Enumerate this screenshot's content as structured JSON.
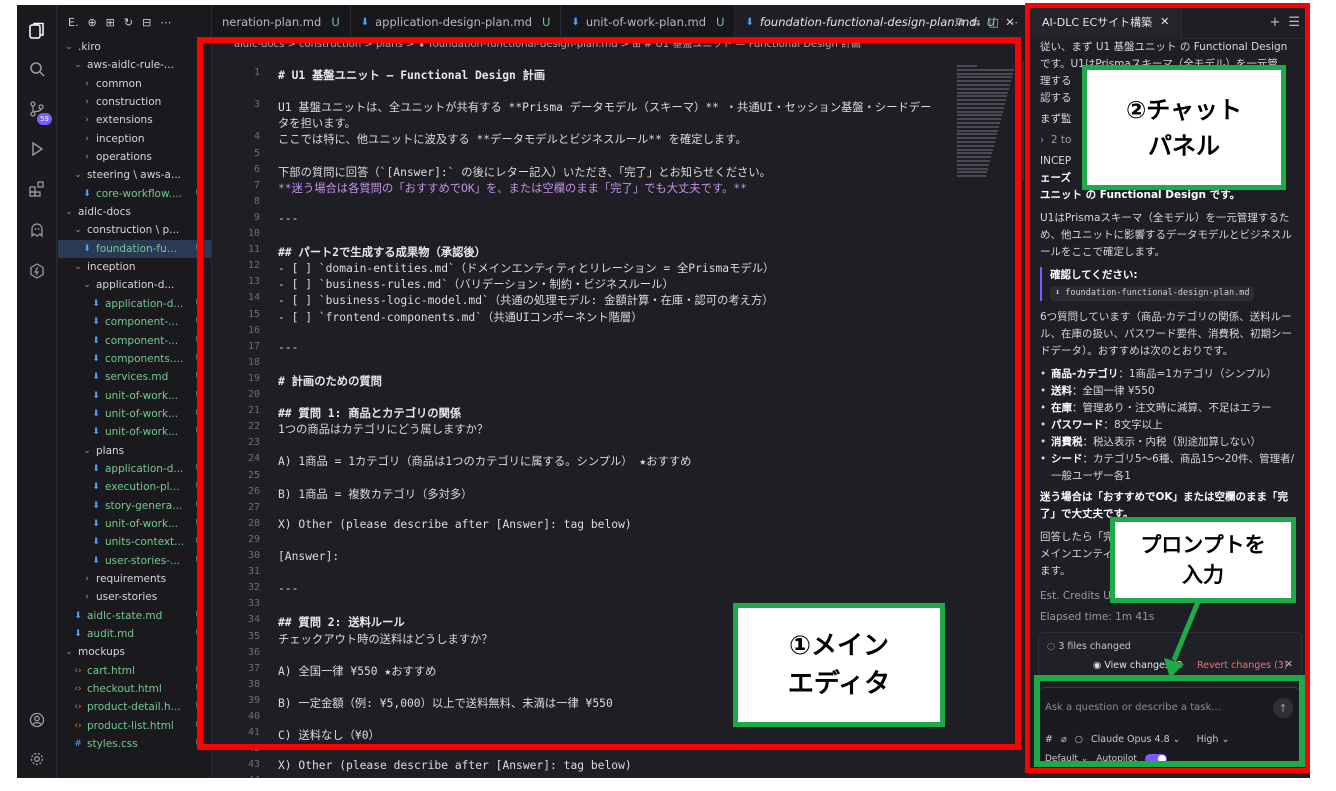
{
  "activity_bar": {
    "icons": [
      "explorer-icon",
      "search-icon",
      "source-control-icon",
      "run-debug-icon",
      "extensions-icon",
      "kiro-ghost-icon",
      "kiro-spec-icon",
      "account-icon",
      "settings-icon"
    ],
    "scm_badge": "59"
  },
  "explorer": {
    "header": "E.",
    "items": [
      {
        "label": ".kiro",
        "depth": 0,
        "kind": "folder",
        "open": true,
        "status": "dot"
      },
      {
        "label": "aws-aidlc-rule-...",
        "depth": 1,
        "kind": "folder",
        "open": true,
        "status": "dot"
      },
      {
        "label": "common",
        "depth": 2,
        "kind": "folder",
        "open": false,
        "status": "dot"
      },
      {
        "label": "construction",
        "depth": 2,
        "kind": "folder",
        "open": false,
        "status": "dot"
      },
      {
        "label": "extensions",
        "depth": 2,
        "kind": "folder",
        "open": false,
        "status": "dot"
      },
      {
        "label": "inception",
        "depth": 2,
        "kind": "folder",
        "open": false,
        "status": "dot"
      },
      {
        "label": "operations",
        "depth": 2,
        "kind": "folder",
        "open": false,
        "status": "dot"
      },
      {
        "label": "steering \\ aws-a...",
        "depth": 1,
        "kind": "folder",
        "open": true,
        "status": "dot"
      },
      {
        "label": "core-workflow....",
        "depth": 2,
        "kind": "md",
        "status": "U"
      },
      {
        "label": "aidlc-docs",
        "depth": 0,
        "kind": "folder",
        "open": true,
        "status": "dot"
      },
      {
        "label": "construction \\ p...",
        "depth": 1,
        "kind": "folder",
        "open": true,
        "status": "dot"
      },
      {
        "label": "foundation-fu...",
        "depth": 2,
        "kind": "md",
        "status": "U",
        "selected": true
      },
      {
        "label": "inception",
        "depth": 1,
        "kind": "folder",
        "open": true,
        "status": "dot"
      },
      {
        "label": "application-d...",
        "depth": 2,
        "kind": "folder",
        "open": true,
        "status": "dot"
      },
      {
        "label": "application-d...",
        "depth": 3,
        "kind": "md",
        "status": "U"
      },
      {
        "label": "component-...",
        "depth": 3,
        "kind": "md",
        "status": "U"
      },
      {
        "label": "component-...",
        "depth": 3,
        "kind": "md",
        "status": "U"
      },
      {
        "label": "components....",
        "depth": 3,
        "kind": "md",
        "status": "U"
      },
      {
        "label": "services.md",
        "depth": 3,
        "kind": "md",
        "status": "U"
      },
      {
        "label": "unit-of-work...",
        "depth": 3,
        "kind": "md",
        "status": "U"
      },
      {
        "label": "unit-of-work...",
        "depth": 3,
        "kind": "md",
        "status": "U"
      },
      {
        "label": "unit-of-work...",
        "depth": 3,
        "kind": "md",
        "status": "U"
      },
      {
        "label": "plans",
        "depth": 2,
        "kind": "folder",
        "open": true,
        "status": "dot"
      },
      {
        "label": "application-d...",
        "depth": 3,
        "kind": "md",
        "status": "U"
      },
      {
        "label": "execution-pl...",
        "depth": 3,
        "kind": "md",
        "status": "U"
      },
      {
        "label": "story-genera...",
        "depth": 3,
        "kind": "md",
        "status": "U"
      },
      {
        "label": "unit-of-work...",
        "depth": 3,
        "kind": "md",
        "status": "U"
      },
      {
        "label": "units-context...",
        "depth": 3,
        "kind": "md",
        "status": "U"
      },
      {
        "label": "user-stories-...",
        "depth": 3,
        "kind": "md",
        "status": "U"
      },
      {
        "label": "requirements",
        "depth": 2,
        "kind": "folder",
        "open": false,
        "status": "dot"
      },
      {
        "label": "user-stories",
        "depth": 2,
        "kind": "folder",
        "open": false,
        "status": "dot"
      },
      {
        "label": "aidlc-state.md",
        "depth": 1,
        "kind": "md",
        "status": "U"
      },
      {
        "label": "audit.md",
        "depth": 1,
        "kind": "md",
        "status": "U"
      },
      {
        "label": "mockups",
        "depth": 0,
        "kind": "folder",
        "open": true,
        "status": "dot"
      },
      {
        "label": "cart.html",
        "depth": 1,
        "kind": "html",
        "status": "U"
      },
      {
        "label": "checkout.html",
        "depth": 1,
        "kind": "html",
        "status": "U"
      },
      {
        "label": "product-detail.h...",
        "depth": 1,
        "kind": "html",
        "status": "U"
      },
      {
        "label": "product-list.html",
        "depth": 1,
        "kind": "html",
        "status": "U"
      },
      {
        "label": "styles.css",
        "depth": 1,
        "kind": "css",
        "status": "U"
      }
    ]
  },
  "editor": {
    "tabs": [
      {
        "label": "neration-plan.md",
        "status": "U",
        "active": false
      },
      {
        "label": "application-design-plan.md",
        "status": "U",
        "active": false
      },
      {
        "label": "unit-of-work-plan.md",
        "status": "U",
        "active": false
      },
      {
        "label": "foundation-functional-design-plan.md",
        "status": "U",
        "active": true
      }
    ],
    "breadcrumb": "aidlc-docs > construction > plans > ⬇ foundation-functional-design-plan.md > ⊞ # U1 基盤ユニット — Functional Design 計画",
    "lines": [
      {
        "n": "1",
        "t": "# U1 基盤ユニット — Functional Design 計画",
        "k": "h"
      },
      {
        "n": "",
        "t": "",
        "k": ""
      },
      {
        "n": "3",
        "t": "U1 基盤ユニットは、全ユニットが共有する **Prisma データモデル（スキーマ）** ・共通UI・セッション基盤・シードデー",
        "k": "p3"
      },
      {
        "n": "",
        "t": "タを担います。",
        "k": ""
      },
      {
        "n": "4",
        "t": "ここでは特に、他ユニットに波及する **データモデルとビジネスルール** を確定します。",
        "k": ""
      },
      {
        "n": "5",
        "t": "",
        "k": ""
      },
      {
        "n": "6",
        "t": "下部の質問に回答（`[Answer]:` の後にレター記入）いただき、「完了」とお知らせください。",
        "k": ""
      },
      {
        "n": "7",
        "t": "**迷う場合は各質問の「おすすめでOK」を、または空欄のまま「完了」でも大丈夫です。**",
        "k": "bold"
      },
      {
        "n": "8",
        "t": "",
        "k": ""
      },
      {
        "n": "9",
        "t": "---",
        "k": ""
      },
      {
        "n": "10",
        "t": "",
        "k": ""
      },
      {
        "n": "11",
        "t": "## パート2で生成する成果物（承認後）",
        "k": "h2"
      },
      {
        "n": "12",
        "t": "- [ ] `domain-entities.md`（ドメインエンティティとリレーション = 全Prismaモデル）",
        "k": ""
      },
      {
        "n": "13",
        "t": "- [ ] `business-rules.md`（バリデーション・制約・ビジネスルール）",
        "k": ""
      },
      {
        "n": "14",
        "t": "- [ ] `business-logic-model.md`（共通の処理モデル: 金額計算・在庫・認可の考え方）",
        "k": ""
      },
      {
        "n": "15",
        "t": "- [ ] `frontend-components.md`（共通UIコンポーネント階層）",
        "k": ""
      },
      {
        "n": "16",
        "t": "",
        "k": ""
      },
      {
        "n": "17",
        "t": "---",
        "k": ""
      },
      {
        "n": "18",
        "t": "",
        "k": ""
      },
      {
        "n": "19",
        "t": "# 計画のための質問",
        "k": "h"
      },
      {
        "n": "20",
        "t": "",
        "k": ""
      },
      {
        "n": "21",
        "t": "## 質問 1: 商品とカテゴリの関係",
        "k": "h2"
      },
      {
        "n": "22",
        "t": "1つの商品はカテゴリにどう属しますか？",
        "k": ""
      },
      {
        "n": "23",
        "t": "",
        "k": ""
      },
      {
        "n": "24",
        "t": "A) 1商品 = 1カテゴリ（商品は1つのカテゴリに属する。シンプル） ★おすすめ",
        "k": "opt"
      },
      {
        "n": "25",
        "t": "",
        "k": ""
      },
      {
        "n": "26",
        "t": "B) 1商品 = 複数カテゴリ（多対多）",
        "k": "opt"
      },
      {
        "n": "27",
        "t": "",
        "k": ""
      },
      {
        "n": "28",
        "t": "X) Other (please describe after [Answer]: tag below)",
        "k": "optx"
      },
      {
        "n": "29",
        "t": "",
        "k": ""
      },
      {
        "n": "30",
        "t": "[Answer]:",
        "k": "ans"
      },
      {
        "n": "31",
        "t": "",
        "k": ""
      },
      {
        "n": "32",
        "t": "---",
        "k": ""
      },
      {
        "n": "33",
        "t": "",
        "k": ""
      },
      {
        "n": "34",
        "t": "## 質問 2: 送料ルール",
        "k": "h2"
      },
      {
        "n": "35",
        "t": "チェックアウト時の送料はどうしますか？",
        "k": ""
      },
      {
        "n": "36",
        "t": "",
        "k": ""
      },
      {
        "n": "37",
        "t": "A) 全国一律 ¥550 ★おすすめ",
        "k": "opt"
      },
      {
        "n": "38",
        "t": "",
        "k": ""
      },
      {
        "n": "39",
        "t": "B) 一定金額（例: ¥5,000）以上で送料無料、未満は一律 ¥550",
        "k": "opt"
      },
      {
        "n": "40",
        "t": "",
        "k": ""
      },
      {
        "n": "41",
        "t": "C) 送料なし（¥0）",
        "k": "opt"
      },
      {
        "n": "42",
        "t": "",
        "k": ""
      },
      {
        "n": "43",
        "t": "X) Other (please describe after [Answer]: tag below)",
        "k": "optx"
      },
      {
        "n": "44",
        "t": "",
        "k": ""
      }
    ]
  },
  "chat": {
    "tab_title": "AI-DLC ECサイト構築",
    "intro": "従い、まず U1 基盤ユニット の Functional Design です。U1はPrismaスキーマ（全モデル）を一元管理するため…認する",
    "intro_line1": "従い、まず U1 基盤ユニット の Functional Design",
    "intro_line2": "です。U1はPrismaスキーマ（全モデル）を一元管",
    "intro_line3": "理する",
    "intro_line4": "認する",
    "small1": "まず監",
    "small2": "2 to",
    "inception": "INCEP",
    "phase_a": "ェーズ",
    "phase_b": "ユニット の Functional Design です。",
    "para1": "U1はPrismaスキーマ（全モデル）を一元管理するため、他ユニットに影響するデータモデルとビジネスルールをここで確定します。",
    "confirm_label": "確認してください:",
    "confirm_file": "foundation-functional-design-plan.md",
    "para2": "6つ質問しています（商品-カテゴリの関係、送料ルール、在庫の扱い、パスワード要件、消費税、初期シードデータ）。おすすめは次のとおりです。",
    "recs": [
      {
        "k": "商品-カテゴリ",
        "v": "：1商品=1カテゴリ（シンプル）"
      },
      {
        "k": "送料",
        "v": "：全国一律 ¥550"
      },
      {
        "k": "在庫",
        "v": "：管理あり・注文時に減算、不足はエラー"
      },
      {
        "k": "パスワード",
        "v": "：8文字以上"
      },
      {
        "k": "消費税",
        "v": "：税込表示・内税（別途加算しない）"
      },
      {
        "k": "シード",
        "v": "：カテゴリ5〜6種、商品15〜20件、管理者/一般ユーザー各1"
      }
    ],
    "bold_note": "迷う場合は「おすすめでOK」または空欄のまま「完了」で大丈夫です。",
    "para3_a": "回答したら「完",
    "para3_b": "メインエンティ",
    "para3_c": "ます。",
    "credits": "Est. Credits Use",
    "elapsed": "Elapsed time: 1m 41s",
    "files_changed": "3 files changed",
    "view_changes": "View changes (3",
    "revert_changes": "Revert changes (3)",
    "prompt_placeholder": "Ask a question or describe a task...",
    "model": "Claude Opus 4.8",
    "effort": "High",
    "mode": "Default",
    "autopilot": "Autopilot"
  },
  "annotations": {
    "editor_label": "①メイン\nエディタ",
    "chat_label": "②チャット\nパネル",
    "prompt_label": "プロンプトを\n入力",
    "red": "#ff0000",
    "green": "#1faa4a"
  }
}
